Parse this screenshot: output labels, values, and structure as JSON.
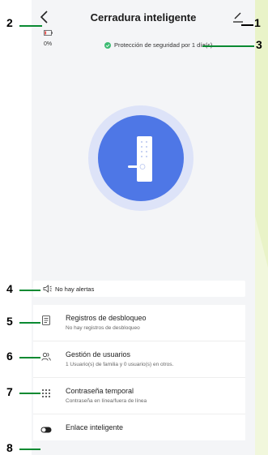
{
  "header": {
    "title": "Cerradura inteligente"
  },
  "battery": {
    "percent": "0%"
  },
  "protection": {
    "text": "Protección de seguridad por 1 día(s)."
  },
  "alerts": {
    "text": "No hay alertas"
  },
  "menu": [
    {
      "title": "Registros de desbloqueo",
      "subtitle": "No hay registros de desbloqueo"
    },
    {
      "title": "Gestión de usuarios",
      "subtitle": "1 Usuario(s) de familia y 0 usuario(s) en otros."
    },
    {
      "title": "Contraseña temporal",
      "subtitle": "Contraseña en línea/fuera de línea"
    },
    {
      "title": "Enlace inteligente",
      "subtitle": ""
    }
  ],
  "callouts": [
    "1",
    "2",
    "3",
    "4",
    "5",
    "6",
    "7",
    "8"
  ],
  "colors": {
    "accent": "#4e77e6",
    "ring": "#dde3f8",
    "callout_line": "#0a8a32",
    "protect_check": "#3dbb73"
  }
}
